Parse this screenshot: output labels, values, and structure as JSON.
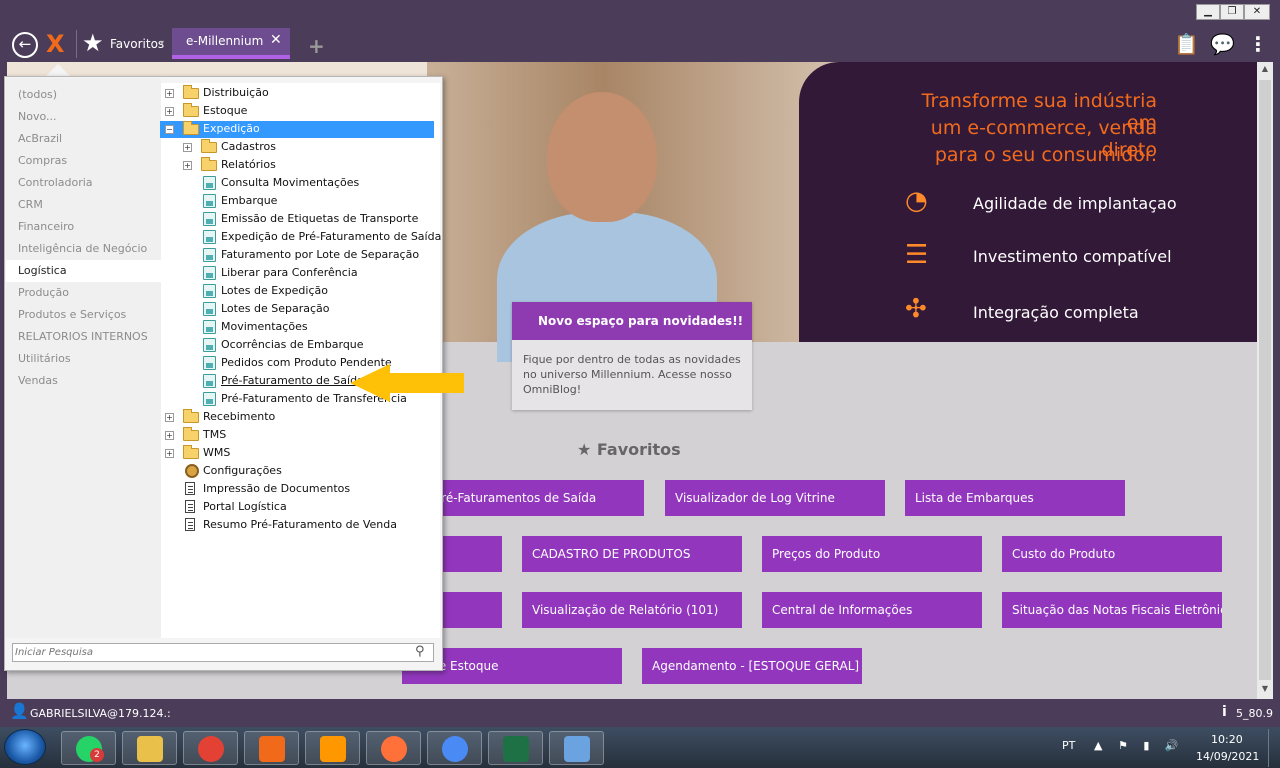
{
  "window": {
    "minimize": "▁",
    "maximize": "❐",
    "close": "✕"
  },
  "appbar": {
    "back_icon": "←",
    "logo_icon": "X",
    "favorites_label": "Favoritos",
    "favorites_chevron": "▾",
    "tab_label": "e-Millennium",
    "tab_close": "✕",
    "add_tab": "+",
    "clipboard_icon": "📋",
    "chat_icon": "💬",
    "more_icon": "⋮"
  },
  "banner": {
    "title_lines": [
      "Transforme sua indústria em",
      "um e-commerce, venda direto",
      "para o seu consumidor."
    ],
    "features": [
      {
        "icon": "speedometer-icon",
        "glyph": "◔",
        "label": "Agilidade de implantaçao"
      },
      {
        "icon": "coins-icon",
        "glyph": "☰",
        "label": "Investimento compatível"
      },
      {
        "icon": "puzzle-icon",
        "glyph": "✣",
        "label": "Integração completa"
      }
    ]
  },
  "news": {
    "title": "Novo espaço para novidades!!",
    "body": "Fique por dentro de todas as novidades no universo Millennium. Acesse nosso OmniBlog!"
  },
  "favorites": {
    "title": "Favoritos",
    "star": "★",
    "buttons": [
      {
        "label": "sta Pré-Faturamentos de Saída"
      },
      {
        "label": "Visualizador de Log Vitrine"
      },
      {
        "label": "Lista de Embarques"
      },
      {
        "label": ""
      },
      {
        "label": "CADASTRO DE PRODUTOS"
      },
      {
        "label": "Preços do Produto"
      },
      {
        "label": "Custo do Produto"
      },
      {
        "label": ""
      },
      {
        "label": "Visualização de Relatório (101)"
      },
      {
        "label": "Central de Informações"
      },
      {
        "label": "Situação das Notas Fiscais Eletrônicas"
      },
      {
        "label": "lta de Estoque"
      },
      {
        "label": "Agendamento - [ESTOQUE GERAL]"
      }
    ]
  },
  "menu": {
    "categories": [
      "(todos)",
      "Novo...",
      "AcBrazil",
      "Compras",
      "Controladoria",
      "CRM",
      "Financeiro",
      "Inteligência de Negócio",
      "Logística",
      "Produção",
      "Produtos e Serviços",
      "RELATORIOS INTERNOS",
      "Utilitários",
      "Vendas"
    ],
    "selected_category": "Logística",
    "tree": [
      {
        "label": "Distribuição",
        "type": "folder",
        "level": 0,
        "expander": "+"
      },
      {
        "label": "Estoque",
        "type": "folder",
        "level": 0,
        "expander": "+"
      },
      {
        "label": "Expedição",
        "type": "folder",
        "level": 0,
        "expander": "−",
        "selected": true
      },
      {
        "label": "Cadastros",
        "type": "folder",
        "level": 1,
        "expander": "+"
      },
      {
        "label": "Relatórios",
        "type": "folder",
        "level": 1,
        "expander": "+"
      },
      {
        "label": "Consulta Movimentações",
        "type": "leaf",
        "level": 1
      },
      {
        "label": "Embarque",
        "type": "leaf",
        "level": 1
      },
      {
        "label": "Emissão de Etiquetas de Transporte",
        "type": "leaf",
        "level": 1
      },
      {
        "label": "Expedição de Pré-Faturamento de Saída",
        "type": "leaf",
        "level": 1
      },
      {
        "label": "Faturamento por Lote de Separação",
        "type": "leaf",
        "level": 1
      },
      {
        "label": "Liberar para Conferência",
        "type": "leaf",
        "level": 1
      },
      {
        "label": "Lotes de Expedição",
        "type": "leaf",
        "level": 1
      },
      {
        "label": "Lotes de Separação",
        "type": "leaf",
        "level": 1
      },
      {
        "label": "Movimentações",
        "type": "leaf",
        "level": 1
      },
      {
        "label": "Ocorrências de Embarque",
        "type": "leaf",
        "level": 1
      },
      {
        "label": "Pedidos com Produto Pendente",
        "type": "leaf",
        "level": 1
      },
      {
        "label": "Pré-Faturamento de Saída",
        "type": "leaf",
        "level": 1,
        "underline": true
      },
      {
        "label": "Pré-Faturamento de Transferência",
        "type": "leaf",
        "level": 1
      },
      {
        "label": "Recebimento",
        "type": "folder",
        "level": 0,
        "expander": "+"
      },
      {
        "label": "TMS",
        "type": "folder",
        "level": 0,
        "expander": "+"
      },
      {
        "label": "WMS",
        "type": "folder",
        "level": 0,
        "expander": "+"
      },
      {
        "label": "Configurações",
        "type": "cog",
        "level": 0
      },
      {
        "label": "Impressão de Documentos",
        "type": "doc",
        "level": 0
      },
      {
        "label": "Portal Logística",
        "type": "doc",
        "level": 0
      },
      {
        "label": "Resumo Pré-Faturamento de Venda",
        "type": "doc",
        "level": 0
      }
    ],
    "search_placeholder": "Iniciar Pesquisa",
    "search_icon": "⚲"
  },
  "statusbar": {
    "user": "GABRIELSILVA@179.124.:",
    "version": "5_80.9",
    "user_icon": "👤",
    "info_icon": "i"
  },
  "taskbar": {
    "apps": [
      {
        "name": "whatsapp",
        "color": "#25d366"
      },
      {
        "name": "file-explorer",
        "color": "#e8c04a"
      },
      {
        "name": "chrome",
        "color": "#e34133"
      },
      {
        "name": "millennium",
        "color": "#f06a1a"
      },
      {
        "name": "sublime",
        "color": "#ff9800"
      },
      {
        "name": "firefox",
        "color": "#ff7139"
      },
      {
        "name": "chrome-profile",
        "color": "#4a8af4"
      },
      {
        "name": "excel",
        "color": "#1e7145"
      },
      {
        "name": "paint",
        "color": "#6aa3e0"
      }
    ],
    "whatsapp_badge": "2",
    "lang": "PT",
    "tray": "▲ ⚑ ▮ 🔊",
    "time": "10:20",
    "date": "14/09/2021"
  },
  "colors": {
    "accent": "#9237bd",
    "banner_orange": "#f26b1d",
    "arrow": "#ffc107",
    "selection": "#3399ff"
  }
}
